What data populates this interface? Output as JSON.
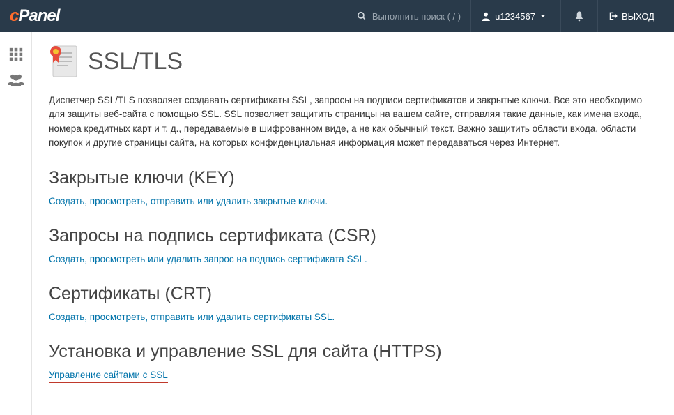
{
  "header": {
    "logo_prefix": "c",
    "logo_rest": "Panel",
    "search_placeholder": "Выполнить поиск ( / )",
    "username": "u1234567",
    "logout": "ВЫХОД"
  },
  "page": {
    "title": "SSL/TLS",
    "intro": "Диспетчер SSL/TLS позволяет создавать сертификаты SSL, запросы на подписи сертификатов и закрытые ключи. Все это необходимо для защиты веб-сайта с помощью SSL. SSL позволяет защитить страницы на вашем сайте, отправляя такие данные, как имена входа, номера кредитных карт и т. д., передаваемые в шифрованном виде, а не как обычный текст. Важно защитить области входа, области покупок и другие страницы сайта, на которых конфиденциальная информация может передаваться через Интернет."
  },
  "sections": [
    {
      "heading": "Закрытые ключи (KEY)",
      "link": "Создать, просмотреть, отправить или удалить закрытые ключи.",
      "highlight": false
    },
    {
      "heading": "Запросы на подпись сертификата (CSR)",
      "link": "Создать, просмотреть или удалить запрос на подпись сертификата SSL.",
      "highlight": false
    },
    {
      "heading": "Сертификаты (CRT)",
      "link": "Создать, просмотреть, отправить или удалить сертификаты SSL.",
      "highlight": false
    },
    {
      "heading": "Установка и управление SSL для сайта (HTTPS)",
      "link": "Управление сайтами с SSL",
      "highlight": true
    }
  ]
}
